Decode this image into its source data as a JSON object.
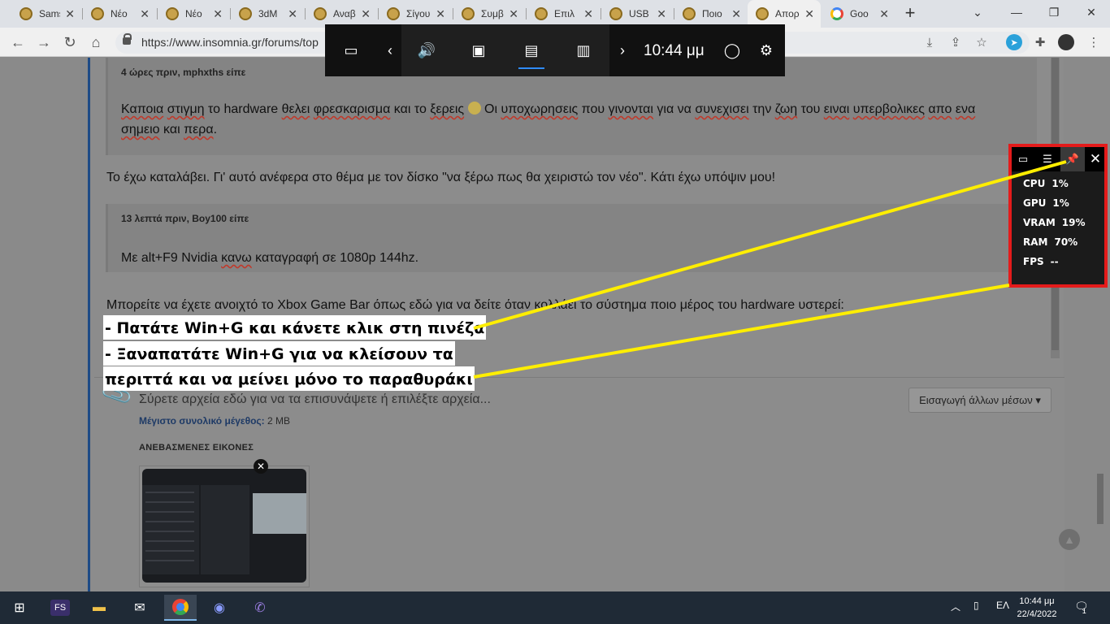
{
  "browser": {
    "tabs": [
      {
        "title": "Sams",
        "icon": "insomnia-favicon-icon"
      },
      {
        "title": "Νέο ",
        "icon": "insomnia-favicon-icon"
      },
      {
        "title": "Νέο ",
        "icon": "insomnia-favicon-icon"
      },
      {
        "title": "3dM",
        "icon": "insomnia-favicon-icon"
      },
      {
        "title": "Αναβ",
        "icon": "insomnia-favicon-icon"
      },
      {
        "title": "Σίγου",
        "icon": "insomnia-favicon-icon"
      },
      {
        "title": "Συμβ",
        "icon": "insomnia-favicon-icon"
      },
      {
        "title": "Επιλ",
        "icon": "insomnia-favicon-icon"
      },
      {
        "title": "USB ",
        "icon": "insomnia-favicon-icon"
      },
      {
        "title": "Ποιο",
        "icon": "insomnia-favicon-icon"
      },
      {
        "title": "Απορ",
        "icon": "insomnia-favicon-icon"
      },
      {
        "title": "Goo",
        "icon": "google-favicon-icon"
      }
    ],
    "url": "https://www.insomnia.gr/forums/top"
  },
  "post": {
    "quote1": {
      "header": "4 ώρες πριν, mphxths είπε",
      "line1_words": [
        "Καποια",
        "στιγμη",
        "το hardware",
        "θελει",
        "φρεσκαρισμα",
        "και το",
        "ξερεις",
        "Οι",
        "υποχωρησεις",
        "που",
        "γινονται",
        "για να",
        "συνεχισει",
        "την",
        "ζωη",
        "του",
        "ειναι",
        "υπερβολικες",
        "απο",
        "ενα"
      ],
      "line2": [
        "σημειο",
        "και",
        "περα",
        "."
      ]
    },
    "reply1": "Το έχω καταλάβει. Γι' αυτό ανέφερα στο θέμα με τον δίσκο \"να ξέρω πως θα χειριστώ τον νέο\". Κάτι έχω υπόψιν μου!",
    "quote2": {
      "header": "13 λεπτά πριν, Boy100 είπε",
      "text_a": "Με alt+F9 Nvidia ",
      "text_sq": "κανω",
      "text_b": " καταγραφή σε 1080p 144hz."
    },
    "reply2": "Μπορείτε να έχετε ανοιχτό το Xbox Game Bar όπως εδώ για να δείτε όταν κολλάει το σύστημα ποιο μέρος του hardware υστερεί:",
    "annotations": [
      "- Πατάτε Win+G και κάνετε κλικ στη πινέζα",
      "- Ξαναπατάτε Win+G για να κλείσουν τα",
      "περιττά και να μείνει μόνο το παραθυράκι"
    ]
  },
  "attachments": {
    "drop_text": "Σύρετε αρχεία εδώ για να τα επισυνάψετε ή επιλέξτε αρχεία...",
    "max_size_label": "Μέγιστο συνολικό μέγεθος:",
    "max_size_value": "2 MB",
    "more_media": "Εισαγωγή άλλων μέσων",
    "uploaded_title": "ΑΝΕΒΑΣΜΕΝΕΣ ΕΙΚΟΝΕΣ"
  },
  "gamebar": {
    "time": "10:44 μμ",
    "icons": [
      "widget-menu-icon",
      "chevron-left-icon",
      "audio-icon",
      "capture-icon",
      "performance-icon",
      "resources-icon",
      "chevron-right-icon",
      "mouse-icon",
      "settings-icon"
    ]
  },
  "performance": {
    "stats": [
      {
        "label": "CPU",
        "value": "1%"
      },
      {
        "label": "GPU",
        "value": "1%"
      },
      {
        "label": "VRAM",
        "value": "19%"
      },
      {
        "label": "RAM",
        "value": "70%"
      },
      {
        "label": "FPS",
        "value": "--"
      }
    ],
    "highlight_color": "#e41b1b",
    "arrow_color": "#ffee00"
  },
  "taskbar": {
    "fs_label": "FS",
    "lang": "ΕΛ",
    "time": "10:44 μμ",
    "date": "22/4/2022",
    "notifications": "1"
  }
}
